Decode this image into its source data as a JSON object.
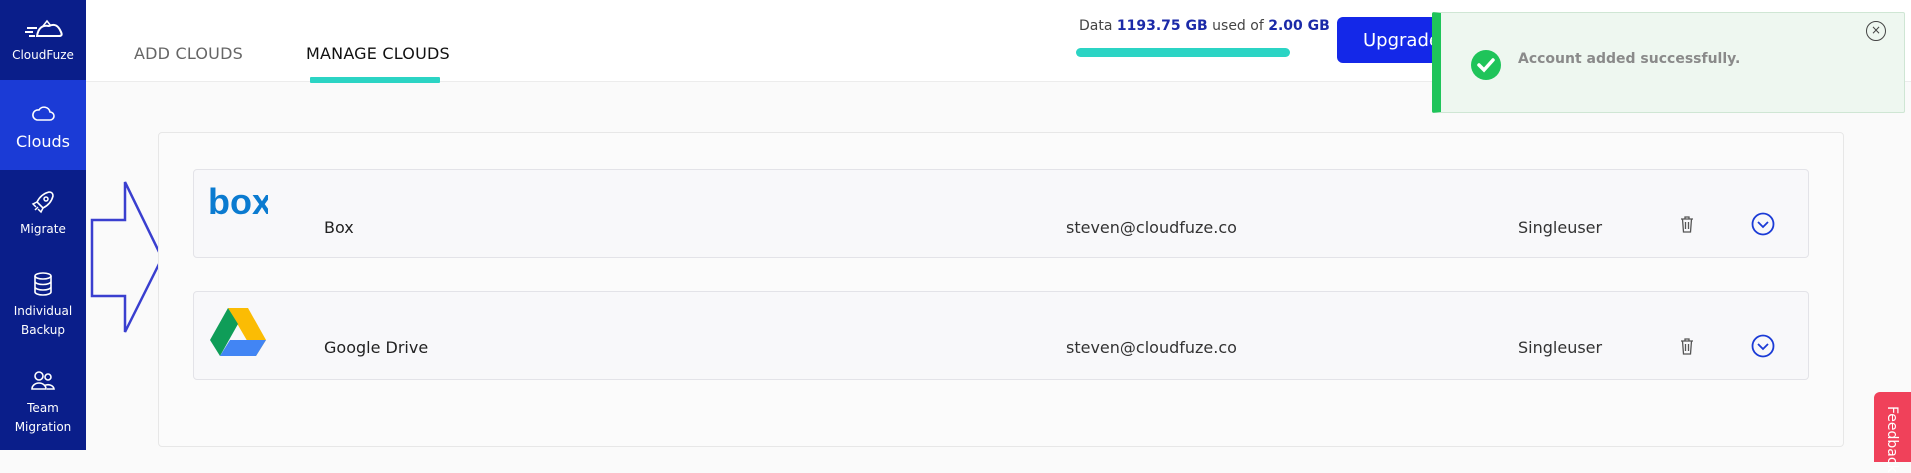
{
  "brand": {
    "label": "CloudFuze"
  },
  "sidebar": {
    "items": [
      {
        "label": "Clouds",
        "icon": "cloud-icon",
        "active": true
      },
      {
        "label": "Migrate",
        "icon": "rocket-icon"
      },
      {
        "label_line1": "Individual",
        "label_line2": "Backup",
        "icon": "database-icon"
      },
      {
        "label_line1": "Team",
        "label_line2": "Migration",
        "icon": "team-icon"
      }
    ]
  },
  "header": {
    "tabs": [
      {
        "label": "ADD CLOUDS"
      },
      {
        "label": "MANAGE CLOUDS",
        "active": true
      }
    ],
    "usage": {
      "prefix": "Data",
      "used": "1193.75 GB",
      "middle": "used of",
      "total": "2.00 GB",
      "fill_fraction": 1.0
    },
    "upgrade_label": "Upgrade"
  },
  "toast": {
    "message": "Account added successfully.",
    "close_glyph": "×",
    "accent_color": "#1fc45a"
  },
  "clouds": [
    {
      "name": "Box",
      "logo_text": "box",
      "email": "steven@cloudfuze.co",
      "type": "Singleuser"
    },
    {
      "name": "Google Drive",
      "email": "steven@cloudfuze.co",
      "type": "Singleuser"
    }
  ],
  "feedback": {
    "label": "Feedback"
  },
  "colors": {
    "sidebar": "#0a1e8a",
    "sidebar_active": "#1b3bd6",
    "accent_teal": "#2bd4c4",
    "upgrade": "#1428e8",
    "feedback": "#f0415a"
  }
}
